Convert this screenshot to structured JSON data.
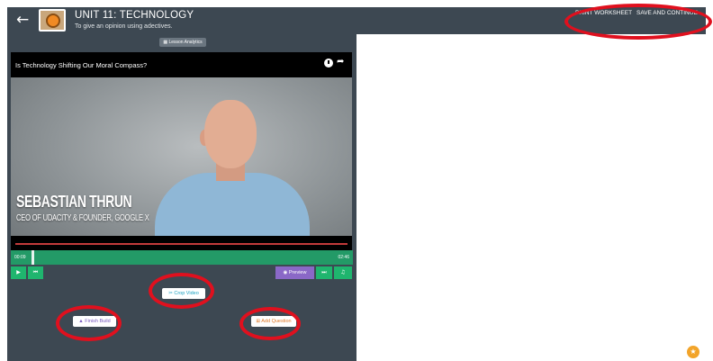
{
  "header": {
    "back_icon": "arrow-left-icon",
    "unit_title": "UNIT 11: TECHNOLOGY",
    "unit_subtitle": "To give an opinion using adectives.",
    "print_worksheet": "PRINT WORKSHEET",
    "save_and_continue": "SAVE AND CONTINUE"
  },
  "editor": {
    "lesson_analytics": "Lesson Analytics",
    "video": {
      "title": "Is Technology Shifting Our Moral Compass?",
      "lower_third_name": "SEBASTIAN THRUN",
      "lower_third_role": "CEO OF UDACITY & FOUNDER, GOOGLE X"
    },
    "timeline": {
      "current_time": "00:09",
      "end_time": "02:46"
    },
    "controls": {
      "preview_label": "Preview"
    },
    "actions": {
      "crop_video": "Crop Video",
      "finish_build": "Finish Build",
      "add_question": "Add Question"
    }
  },
  "colors": {
    "panel": "#3d4852",
    "timeline_green": "#239a67",
    "control_green": "#1fb56e",
    "preview_purple": "#8a68c7",
    "annotation_red": "#e0101e",
    "help_orange": "#f2a42a"
  }
}
